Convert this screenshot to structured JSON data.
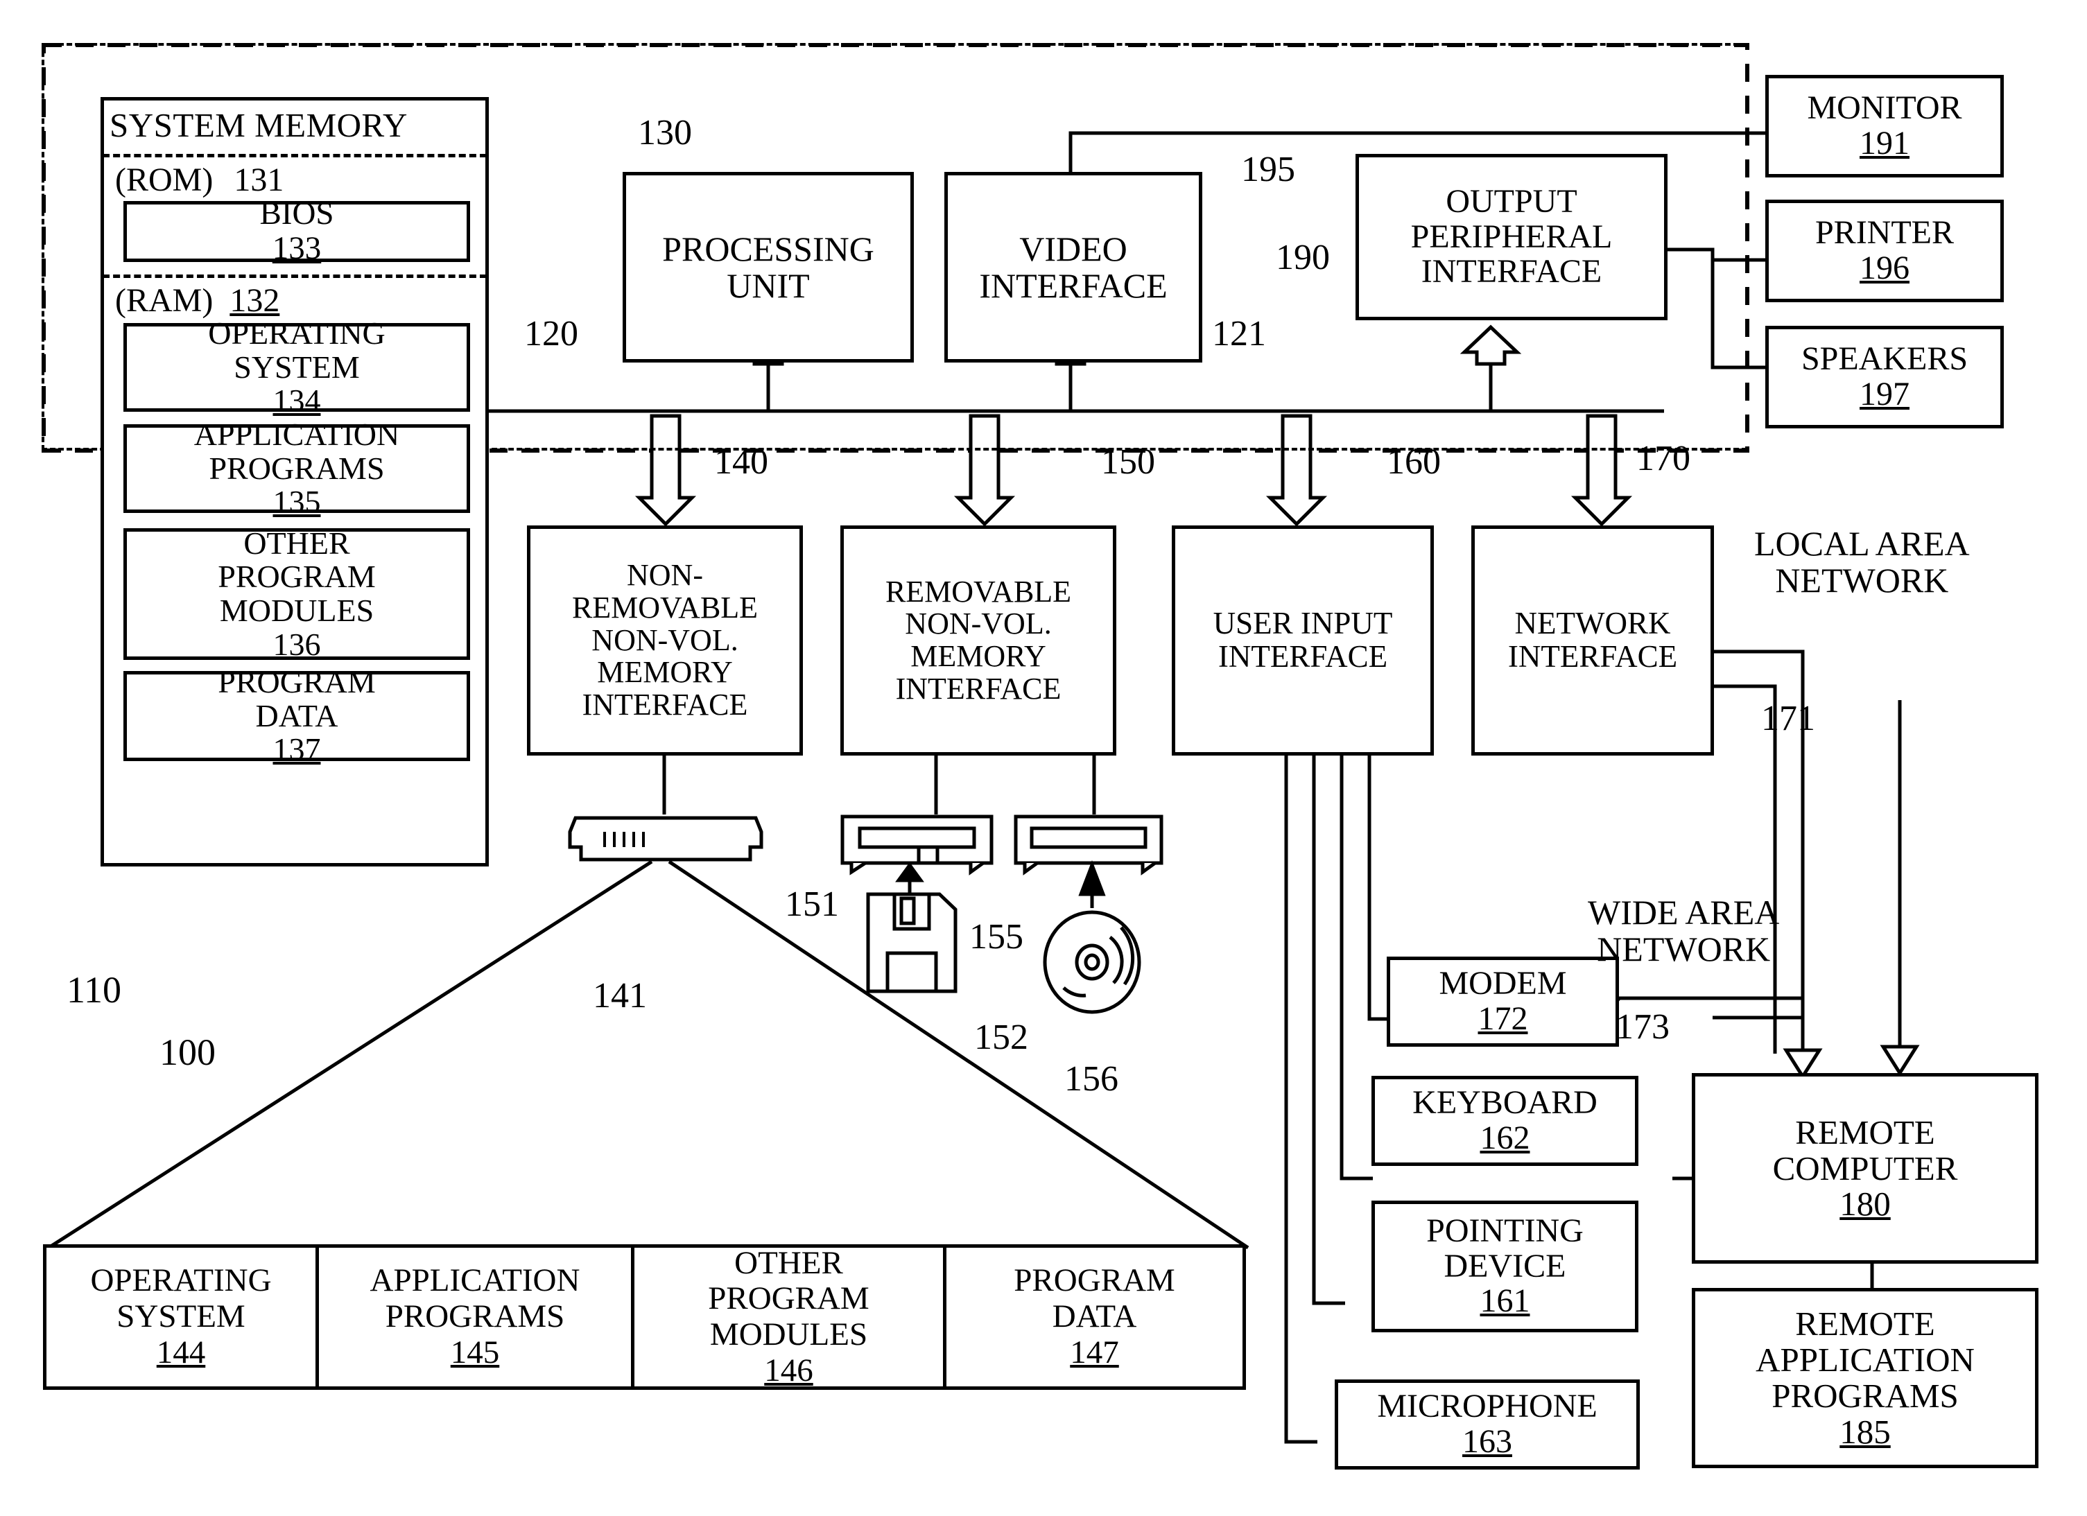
{
  "figure": {
    "title": "Computing system environment block diagram",
    "line_color": "#000000",
    "background": "#ffffff"
  },
  "boundary": {
    "computer_ref": "110",
    "environment_ref": "100"
  },
  "system_memory": {
    "title": "SYSTEM MEMORY",
    "ref": "130",
    "rom": {
      "label": "(ROM)",
      "ref": "131"
    },
    "bios": {
      "label": "BIOS",
      "ref": "133"
    },
    "ram": {
      "label": "(RAM)",
      "ref": "132"
    },
    "items": [
      {
        "line1": "OPERATING",
        "line2": "SYSTEM",
        "ref": "134"
      },
      {
        "line1": "APPLICATION",
        "line2": "PROGRAMS",
        "ref": "135"
      },
      {
        "line1": "OTHER",
        "line2": "PROGRAM",
        "line3": "MODULES",
        "ref": "136"
      },
      {
        "line1": "PROGRAM",
        "line2": "DATA",
        "ref": "137"
      }
    ]
  },
  "processing_unit": {
    "line1": "PROCESSING",
    "line2": "UNIT",
    "ref": "120"
  },
  "system_bus": {
    "ref": "121"
  },
  "video_interface": {
    "line1": "VIDEO",
    "line2": "INTERFACE",
    "ref": "190"
  },
  "output_peripheral_interface": {
    "line1": "OUTPUT",
    "line2": "PERIPHERAL",
    "line3": "INTERFACE",
    "ref": "195"
  },
  "output_devices": [
    {
      "label": "MONITOR",
      "ref": "191"
    },
    {
      "label": "PRINTER",
      "ref": "196"
    },
    {
      "label": "SPEAKERS",
      "ref": "197"
    }
  ],
  "non_removable_interface": {
    "line1": "NON-",
    "line2": "REMOVABLE",
    "line3": "NON-VOL.",
    "line4": "MEMORY",
    "line5": "INTERFACE",
    "ref": "140"
  },
  "removable_interface": {
    "line1": "REMOVABLE",
    "line2": "NON-VOL.",
    "line3": "MEMORY",
    "line4": "INTERFACE",
    "ref": "150"
  },
  "user_input_interface": {
    "line1": "USER INPUT",
    "line2": "INTERFACE",
    "ref": "160"
  },
  "network_interface": {
    "line1": "NETWORK",
    "line2": "INTERFACE",
    "ref": "170"
  },
  "drive_refs": {
    "hard_disk_drive": "141",
    "magnetic_disk_drive": "151",
    "magnetic_disk": "152",
    "optical_disk_drive": "155",
    "optical_disk": "156"
  },
  "networks": {
    "lan": {
      "line1": "LOCAL AREA",
      "line2": "NETWORK",
      "ref": "171"
    },
    "wan": {
      "line1": "WIDE AREA",
      "line2": "NETWORK",
      "ref": "173"
    }
  },
  "input_devices": [
    {
      "label": "MODEM",
      "ref": "172"
    },
    {
      "label": "KEYBOARD",
      "ref": "162"
    },
    {
      "line1": "POINTING",
      "line2": "DEVICE",
      "ref": "161"
    },
    {
      "label": "MICROPHONE",
      "ref": "163"
    }
  ],
  "remote": {
    "computer": {
      "line1": "REMOTE",
      "line2": "COMPUTER",
      "ref": "180"
    },
    "application_programs": {
      "line1": "REMOTE",
      "line2": "APPLICATION",
      "line3": "PROGRAMS",
      "ref": "185"
    }
  },
  "callout_modules": [
    {
      "line1": "OPERATING",
      "line2": "SYSTEM",
      "ref": "144"
    },
    {
      "line1": "APPLICATION",
      "line2": "PROGRAMS",
      "ref": "145"
    },
    {
      "line1": "OTHER",
      "line2": "PROGRAM",
      "line3": "MODULES",
      "ref": "146"
    },
    {
      "line1": "PROGRAM",
      "line2": "DATA",
      "ref": "147"
    }
  ]
}
